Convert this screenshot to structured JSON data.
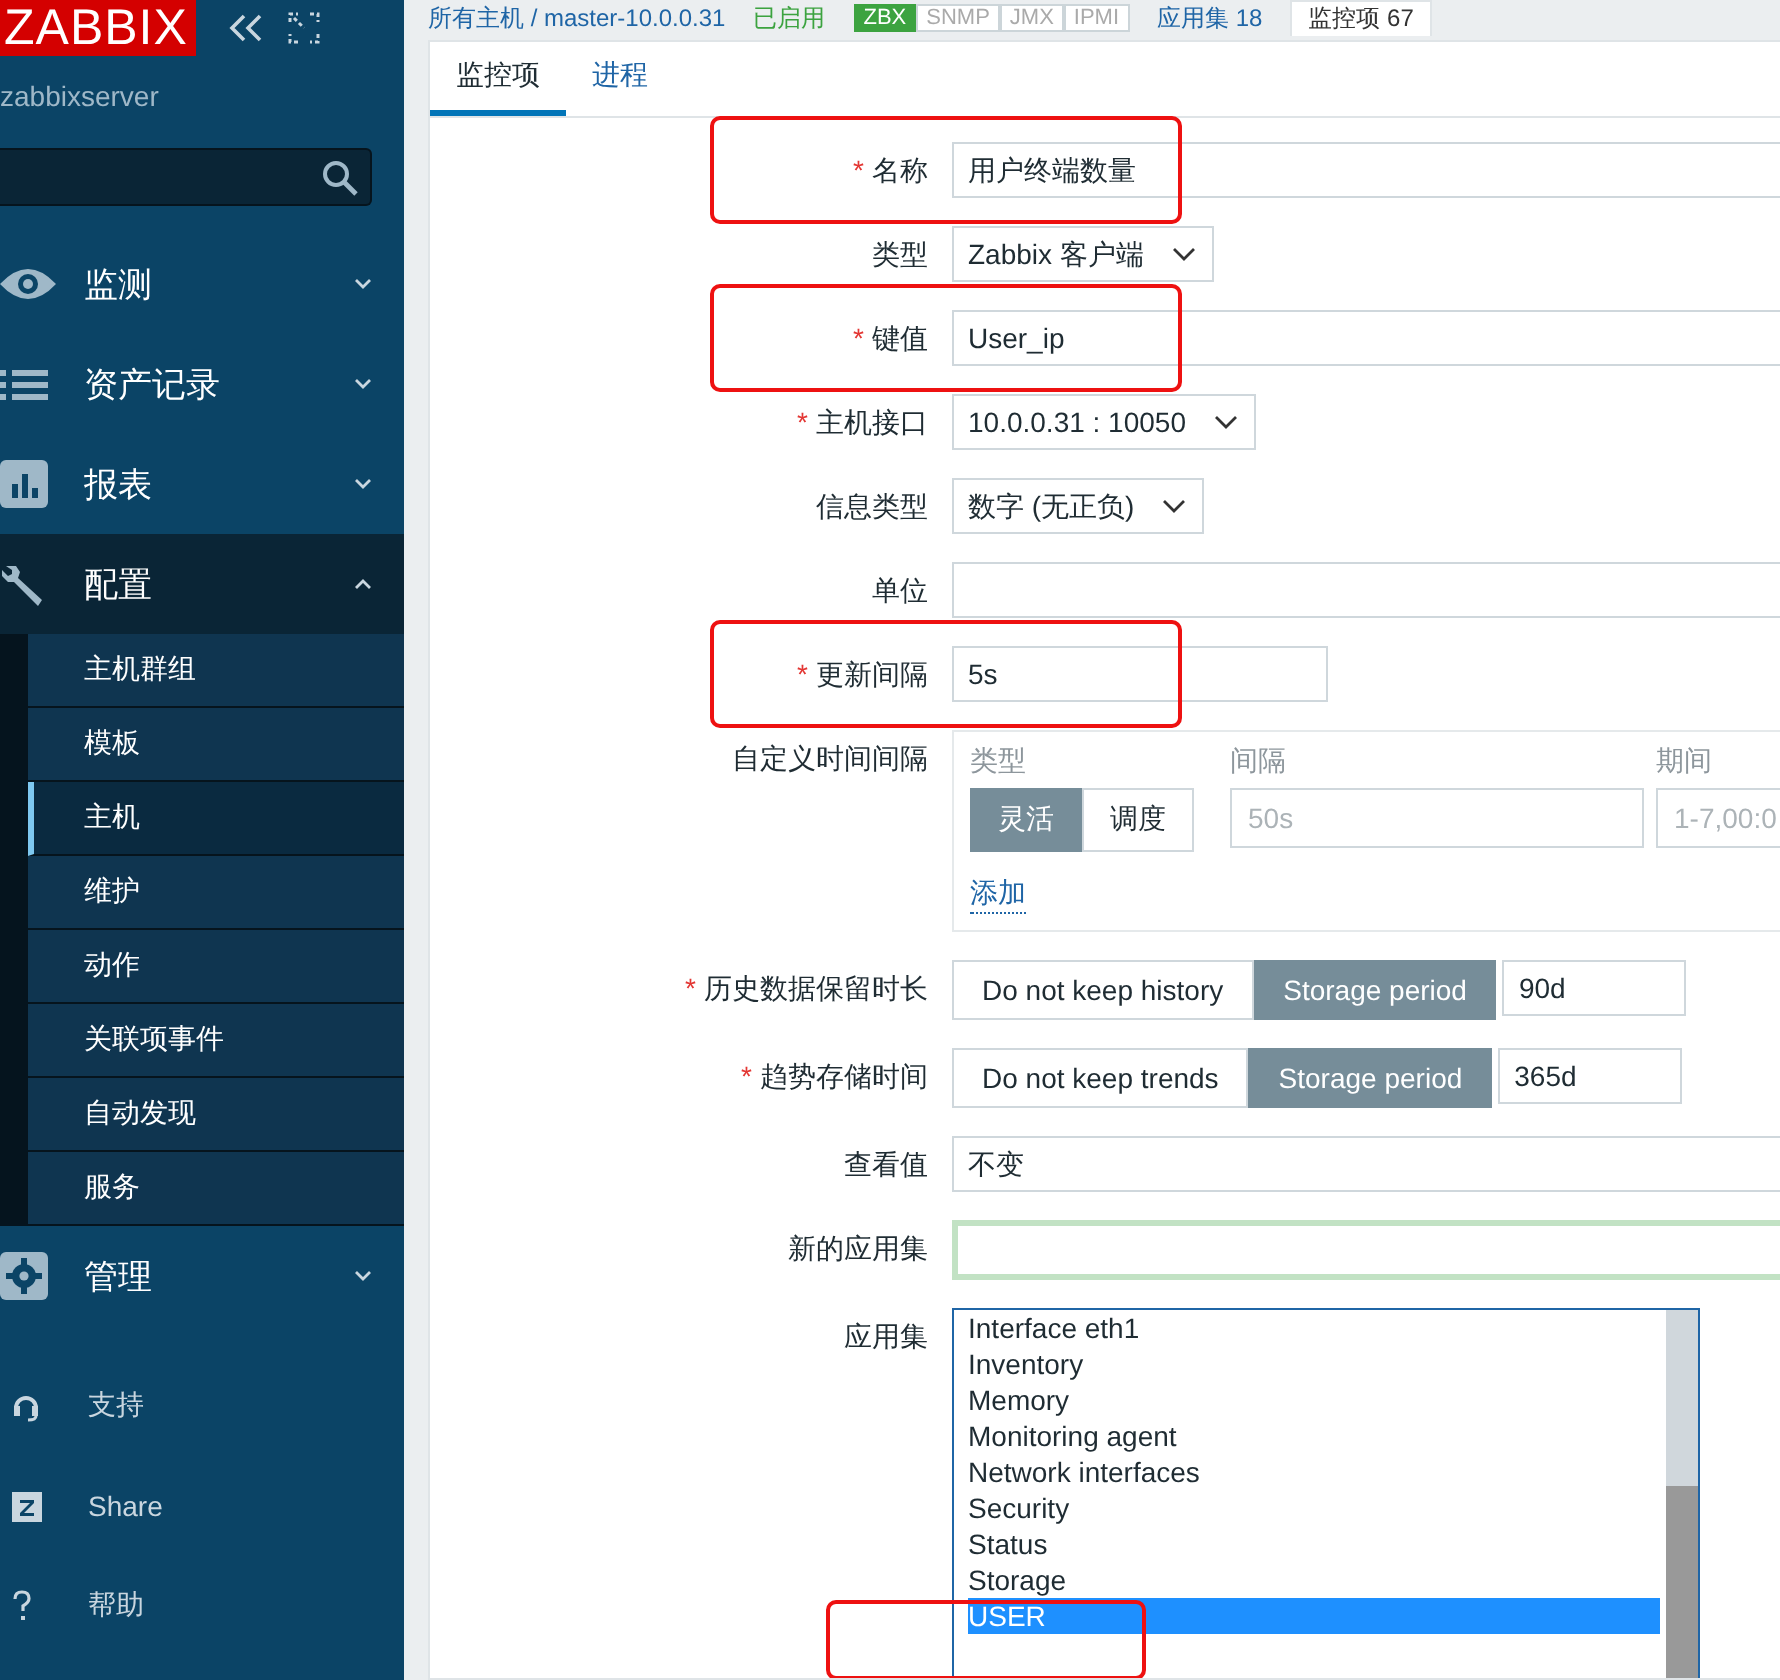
{
  "sidebar": {
    "logo": "ZABBIX",
    "server": "zabbixserver",
    "menu": [
      {
        "label": "监测",
        "expanded": false
      },
      {
        "label": "资产记录",
        "expanded": false
      },
      {
        "label": "报表",
        "expanded": false
      },
      {
        "label": "配置",
        "expanded": true,
        "children": [
          {
            "label": "主机群组",
            "selected": false
          },
          {
            "label": "模板",
            "selected": false
          },
          {
            "label": "主机",
            "selected": true
          },
          {
            "label": "维护",
            "selected": false
          },
          {
            "label": "动作",
            "selected": false
          },
          {
            "label": "关联项事件",
            "selected": false
          },
          {
            "label": "自动发现",
            "selected": false
          },
          {
            "label": "服务",
            "selected": false
          }
        ]
      },
      {
        "label": "管理",
        "expanded": false
      }
    ],
    "links": [
      "支持",
      "Share",
      "帮助"
    ]
  },
  "header": {
    "breadcrumb": "所有主机 / master-10.0.0.31",
    "status": "已启用",
    "badges": [
      {
        "label": "ZBX",
        "on": true
      },
      {
        "label": "SNMP",
        "on": false
      },
      {
        "label": "JMX",
        "on": false
      },
      {
        "label": "IPMI",
        "on": false
      }
    ],
    "links": [
      {
        "label": "应用集 18",
        "selected": false
      },
      {
        "label": "监控项 67",
        "selected": true
      }
    ]
  },
  "tabs": [
    {
      "label": "监控项",
      "selected": true
    },
    {
      "label": "进程",
      "selected": false
    }
  ],
  "form": [
    {
      "kind": "text",
      "label": "名称",
      "required_mark": "*",
      "annotated": true,
      "value": "用户终端数量"
    },
    {
      "kind": "select",
      "label": "类型",
      "value": "Zabbix 客户端"
    },
    {
      "kind": "text",
      "label": "键值",
      "required_mark": "*",
      "annotated": true,
      "value": "User_ip"
    },
    {
      "kind": "select",
      "label": "主机接口",
      "required_mark": "*",
      "value": "10.0.0.31 : 10050"
    },
    {
      "kind": "select",
      "label": "信息类型",
      "value": "数字 (无正负)"
    },
    {
      "kind": "text",
      "label": "单位"
    },
    {
      "kind": "short-text",
      "label": "更新间隔",
      "required_mark": "*",
      "annotated": true,
      "value": "5s"
    },
    {
      "kind": "intervals",
      "label": "自定义时间间隔",
      "columns": [
        "类型",
        "间隔",
        "期间"
      ],
      "modes": [
        {
          "label": "灵活",
          "selected": true
        },
        {
          "label": "调度",
          "selected": false
        }
      ],
      "interval_placeholder": "50s",
      "period_placeholder": "1-7,00:0",
      "add": "添加"
    },
    {
      "kind": "storage",
      "label": "历史数据保留时长",
      "required_mark": "*",
      "options": [
        {
          "label": "Do not keep history",
          "selected": false
        },
        {
          "label": "Storage period",
          "selected": true
        }
      ],
      "value": "90d"
    },
    {
      "kind": "storage",
      "label": "趋势存储时间",
      "required_mark": "*",
      "options": [
        {
          "label": "Do not keep trends",
          "selected": false
        },
        {
          "label": "Storage period",
          "selected": true
        }
      ],
      "value": "365d"
    },
    {
      "kind": "text",
      "label": "查看值",
      "value": "不变"
    },
    {
      "kind": "text",
      "label": "新的应用集",
      "focused": true
    },
    {
      "kind": "listbox",
      "label": "应用集",
      "annotated": true,
      "items": [
        {
          "label": "Interface eth1",
          "selected": false
        },
        {
          "label": "Inventory",
          "selected": false
        },
        {
          "label": "Memory",
          "selected": false
        },
        {
          "label": "Monitoring agent",
          "selected": false
        },
        {
          "label": "Network interfaces",
          "selected": false
        },
        {
          "label": "Security",
          "selected": false
        },
        {
          "label": "Status",
          "selected": false
        },
        {
          "label": "Storage",
          "selected": false
        },
        {
          "label": "USER",
          "selected": true
        }
      ]
    }
  ]
}
